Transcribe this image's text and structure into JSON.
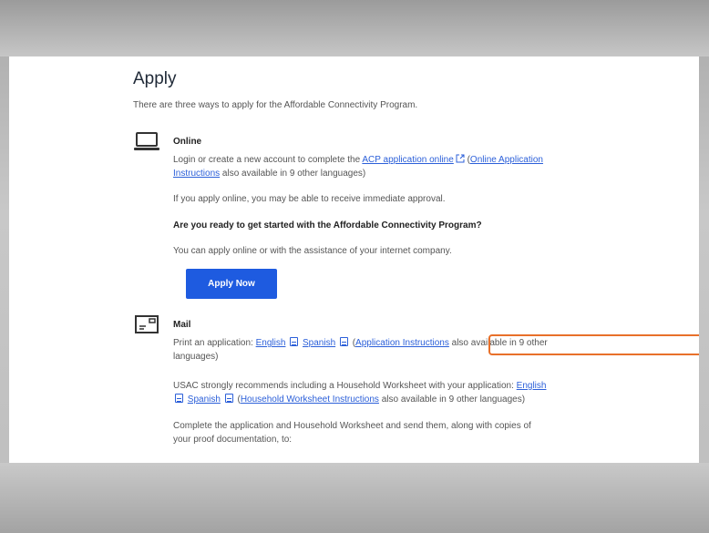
{
  "page": {
    "title": "Apply",
    "intro": "There are three ways to apply for the Affordable Connectivity Program."
  },
  "online": {
    "icon": "laptop-icon",
    "title": "Online",
    "line1_prefix": "Login or create a new account to complete the ",
    "acp_link": "ACP application online",
    "instructions_open": " (",
    "instructions_link_a": "Online Application",
    "instructions_link_b": "Instructions",
    "instructions_suffix": " also available in 9 other languages)",
    "immediate": "If you apply online, you may be able to receive immediate approval.",
    "question": "Are you ready to get started with the Affordable Connectivity Program?",
    "assist": "You can apply online or with the assistance of your internet company.",
    "apply_button": "Apply Now"
  },
  "mail": {
    "icon": "mail-icon",
    "title": "Mail",
    "print_prefix": "Print an application: ",
    "english_link": "English",
    "spanish_link": "Spanish",
    "instr_open": " (",
    "instr_link": "Application Instructions",
    "instr_suffix": " also available in 9 other",
    "instr_suffix2": "languages)",
    "usac_line": "USAC strongly recommends including a Household Worksheet with your application: ",
    "hw_english": "English",
    "hw_spanish": "Spanish",
    "hw_open": " (",
    "hw_link": "Household Worksheet Instructions",
    "hw_suffix": " also available in 9 other languages)",
    "complete_line": "Complete the application and Household Worksheet and send them, along with copies of",
    "complete_line2": "your proof documentation, to:"
  },
  "colors": {
    "link": "#2b5fd9",
    "button": "#1e5be0",
    "highlight": "#e8702a"
  }
}
